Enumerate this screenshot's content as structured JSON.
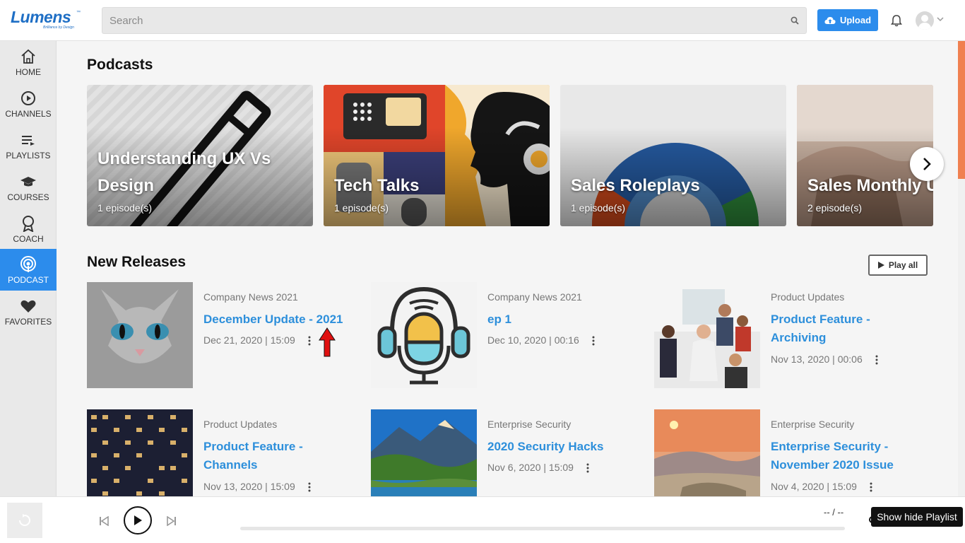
{
  "header": {
    "logo_text": "Lumens",
    "logo_tagline": "Brilliance by Design",
    "logo_tm": "™",
    "search_placeholder": "Search",
    "upload_label": "Upload"
  },
  "sidebar": {
    "items": [
      {
        "label": "HOME",
        "icon": "home-icon"
      },
      {
        "label": "CHANNELS",
        "icon": "play-circle-icon"
      },
      {
        "label": "PLAYLISTS",
        "icon": "playlist-icon"
      },
      {
        "label": "COURSES",
        "icon": "graduation-cap-icon"
      },
      {
        "label": "COACH",
        "icon": "coach-icon"
      },
      {
        "label": "PODCAST",
        "icon": "podcast-icon",
        "active": true
      },
      {
        "label": "FAVORITES",
        "icon": "heart-icon"
      }
    ]
  },
  "podcasts": {
    "title": "Podcasts",
    "cards": [
      {
        "title": "Understanding UX Vs Design",
        "count": "1 episode(s)"
      },
      {
        "title": "Tech Talks",
        "count": "1 episode(s)"
      },
      {
        "title": "Sales Roleplays",
        "count": "1 episode(s)"
      },
      {
        "title": "Sales Monthly U",
        "count": "2 episode(s)"
      }
    ]
  },
  "new_releases": {
    "title": "New Releases",
    "play_all_label": "Play all",
    "items": [
      {
        "category": "Company News 2021",
        "title": "December Update - 2021",
        "meta": "Dec 21, 2020 | 15:09"
      },
      {
        "category": "Company News 2021",
        "title": "ep 1",
        "meta": "Dec 10, 2020 | 00:16"
      },
      {
        "category": "Product Updates",
        "title": "Product Feature - Archiving",
        "meta": "Nov 13, 2020 | 00:06"
      },
      {
        "category": "Product Updates",
        "title": "Product Feature - Channels",
        "meta": "Nov 13, 2020 | 15:09"
      },
      {
        "category": "Enterprise Security",
        "title": "2020 Security Hacks",
        "meta": "Nov 6, 2020 | 15:09"
      },
      {
        "category": "Enterprise Security",
        "title": "Enterprise Security - November 2020 Issue",
        "meta": "Nov 4, 2020 | 15:09"
      }
    ]
  },
  "player": {
    "time": "-- / --",
    "tooltip": "Show hide Playlist"
  },
  "colors": {
    "accent": "#2c8cec",
    "link": "#2d8fdb",
    "scroll": "#f08050"
  }
}
